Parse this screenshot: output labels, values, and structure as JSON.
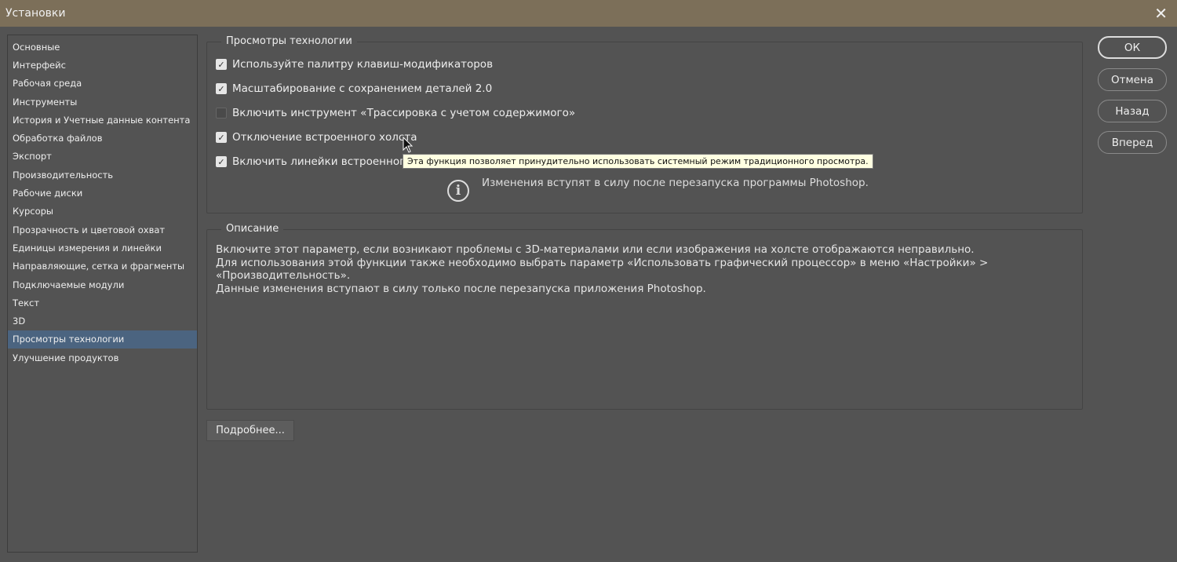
{
  "window": {
    "title": "Установки"
  },
  "sidebar": {
    "items": [
      {
        "label": "Основные"
      },
      {
        "label": "Интерфейс"
      },
      {
        "label": "Рабочая среда"
      },
      {
        "label": "Инструменты"
      },
      {
        "label": "История и Учетные данные контента"
      },
      {
        "label": "Обработка файлов"
      },
      {
        "label": "Экспорт"
      },
      {
        "label": "Производительность"
      },
      {
        "label": "Рабочие диски"
      },
      {
        "label": "Курсоры"
      },
      {
        "label": "Прозрачность и цветовой охват"
      },
      {
        "label": "Единицы измерения и линейки"
      },
      {
        "label": "Направляющие, сетка и фрагменты"
      },
      {
        "label": "Подключаемые модули"
      },
      {
        "label": "Текст"
      },
      {
        "label": "3D"
      },
      {
        "label": "Просмотры технологии",
        "selected": true
      },
      {
        "label": "Улучшение продуктов"
      }
    ]
  },
  "tech": {
    "legend": "Просмотры технологии",
    "options": [
      {
        "label": "Используйте палитру клавиш-модификаторов",
        "checked": true
      },
      {
        "label": "Масштабирование с сохранением деталей 2.0",
        "checked": true
      },
      {
        "label": "Включить инструмент «Трассировка с учетом содержимого»",
        "checked": false
      },
      {
        "label": "Отключение встроенного холста",
        "checked": true
      },
      {
        "label": "Включить линейки встроенного х",
        "checked": true
      }
    ],
    "info": "Изменения вступят в силу после перезапуска программы Photoshop."
  },
  "tooltip": "Эта функция позволяет принудительно использовать системный режим традиционного просмотра.",
  "description": {
    "legend": "Описание",
    "lines": [
      "Включите этот параметр, если возникают проблемы с 3D-материалами или если изображения на холсте отображаются неправильно.",
      "Для использования этой функции также необходимо выбрать параметр «Использовать графический процессор» в меню «Настройки» > «Производительность».",
      "Данные изменения вступают в силу только после перезапуска приложения Photoshop."
    ]
  },
  "buttons": {
    "ok": "ОК",
    "cancel": "Отмена",
    "back": "Назад",
    "forward": "Вперед",
    "more": "Подробнее..."
  }
}
